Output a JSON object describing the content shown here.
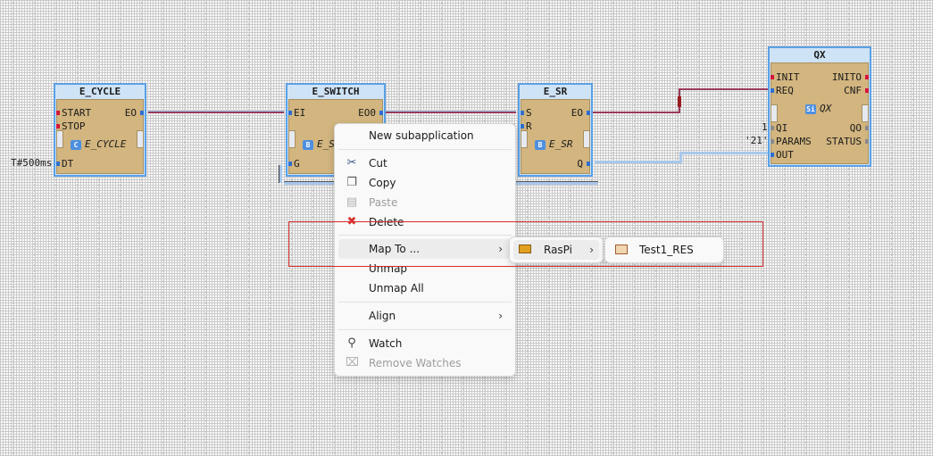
{
  "blocks": {
    "e_cycle": {
      "title": "E_CYCLE",
      "type_label": "E_CYCLE",
      "badge": "C",
      "inputs": [
        "START",
        "STOP",
        "DT"
      ],
      "outputs": [
        "EO"
      ],
      "param_dt": "T#500ms"
    },
    "e_switch": {
      "title": "E_SWITCH",
      "type_label": "E_S",
      "badge": "B",
      "inputs": [
        "EI",
        "G"
      ],
      "outputs": [
        "EO0"
      ]
    },
    "e_sr": {
      "title": "E_SR",
      "type_label": "E_SR",
      "badge": "B",
      "inputs": [
        "S",
        "R"
      ],
      "outputs": [
        "EO",
        "Q"
      ]
    },
    "qx": {
      "title": "QX",
      "type_label": "QX",
      "badge": "Si",
      "inputs": [
        "INIT",
        "REQ",
        "QI",
        "PARAMS",
        "OUT"
      ],
      "outputs": [
        "INITO",
        "CNF",
        "QO",
        "STATUS"
      ],
      "param_qi": "1",
      "param_params": "'21'"
    }
  },
  "context_menu": {
    "items": {
      "new_subapp": "New subapplication",
      "cut": "Cut",
      "copy": "Copy",
      "paste": "Paste",
      "delete": "Delete",
      "map_to": "Map To ...",
      "unmap": "Unmap",
      "unmap_all": "Unmap All",
      "align": "Align",
      "watch": "Watch",
      "remove_watches": "Remove Watches"
    },
    "chevron": "›"
  },
  "submenu_device": {
    "label": "RasPi"
  },
  "submenu_resource": {
    "label": "Test1_RES"
  },
  "colors": {
    "fb_border": "#5aa0e6",
    "fb_body": "#d2b57f",
    "event_pin": "#d4143c",
    "data_pin": "#2c6fd1",
    "highlight": "#d62c2c"
  }
}
